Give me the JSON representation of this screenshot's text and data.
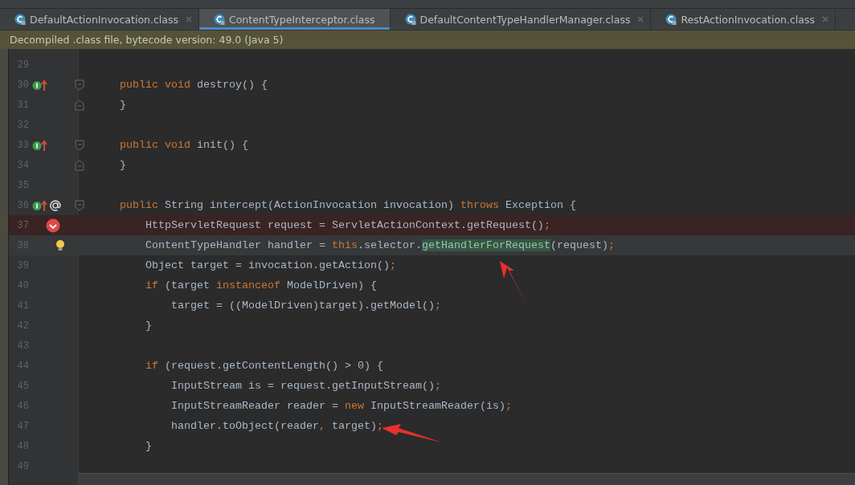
{
  "tabs": [
    {
      "label": "DefaultActionInvocation.class",
      "selected": false
    },
    {
      "label": "ContentTypeInterceptor.class",
      "selected": true
    },
    {
      "label": "DefaultContentTypeHandlerManager.class",
      "selected": false
    },
    {
      "label": "RestActionInvocation.class",
      "selected": false
    }
  ],
  "banner": "Decompiled .class file, bytecode version: 49.0 (Java 5)",
  "lines": [
    {
      "number": "29"
    },
    {
      "number": "30",
      "gutter": [
        {
          "kind": "implements"
        }
      ],
      "fold_start": true,
      "tokens": [
        {
          "text": "    public void ",
          "kind": "keyword"
        },
        {
          "text": "destroy() {",
          "kind": "plain"
        }
      ]
    },
    {
      "number": "31",
      "fold_end": true,
      "tokens": [
        {
          "text": "    }",
          "kind": "plain"
        }
      ]
    },
    {
      "number": "32"
    },
    {
      "number": "33",
      "gutter": [
        {
          "kind": "implements"
        }
      ],
      "fold_start": true,
      "tokens": [
        {
          "text": "    public void ",
          "kind": "keyword"
        },
        {
          "text": "init() {",
          "kind": "plain"
        }
      ]
    },
    {
      "number": "34",
      "fold_end": true,
      "tokens": [
        {
          "text": "    }",
          "kind": "plain"
        }
      ]
    },
    {
      "number": "35"
    },
    {
      "number": "36",
      "gutter": [
        {
          "kind": "implements"
        },
        {
          "kind": "annotation"
        }
      ],
      "fold_start": true,
      "tokens": [
        {
          "text": "    public ",
          "kind": "keyword"
        },
        {
          "text": "String intercept(ActionInvocation invocation) ",
          "kind": "plain"
        },
        {
          "text": "throws ",
          "kind": "keyword"
        },
        {
          "text": "Exception {",
          "kind": "plain"
        }
      ]
    },
    {
      "number": "37",
      "gutter": [
        {
          "kind": "breakpoint"
        }
      ],
      "breakpoint": true,
      "tokens": [
        {
          "text": "        HttpServletRequest request = ServletActionContext.getRequest()",
          "kind": "plain"
        },
        {
          "text": ";",
          "kind": "keyword"
        }
      ]
    },
    {
      "number": "38",
      "gutter": [
        {
          "kind": "bulb"
        }
      ],
      "current": true,
      "tokens": [
        {
          "text": "        ContentTypeHandler handler = ",
          "kind": "plain"
        },
        {
          "text": "this",
          "kind": "keyword"
        },
        {
          "text": ".selector.",
          "kind": "plain"
        },
        {
          "text": "getHandlerForRequest",
          "kind": "match"
        },
        {
          "text": "(request)",
          "kind": "plain"
        },
        {
          "text": ";",
          "kind": "keyword"
        }
      ]
    },
    {
      "number": "39",
      "tokens": [
        {
          "text": "        Object target = invocation.getAction()",
          "kind": "plain"
        },
        {
          "text": ";",
          "kind": "keyword"
        }
      ]
    },
    {
      "number": "40",
      "tokens": [
        {
          "text": "        if ",
          "kind": "keyword"
        },
        {
          "text": "(target ",
          "kind": "plain"
        },
        {
          "text": "instanceof ",
          "kind": "keyword"
        },
        {
          "text": "ModelDriven) {",
          "kind": "plain"
        }
      ]
    },
    {
      "number": "41",
      "tokens": [
        {
          "text": "            target = ((ModelDriven)target).getModel()",
          "kind": "plain"
        },
        {
          "text": ";",
          "kind": "keyword"
        }
      ]
    },
    {
      "number": "42",
      "tokens": [
        {
          "text": "        }",
          "kind": "plain"
        }
      ]
    },
    {
      "number": "43"
    },
    {
      "number": "44",
      "tokens": [
        {
          "text": "        if ",
          "kind": "keyword"
        },
        {
          "text": "(request.getContentLength() > 0) {",
          "kind": "plain"
        }
      ]
    },
    {
      "number": "45",
      "tokens": [
        {
          "text": "            InputStream is = request.getInputStream()",
          "kind": "plain"
        },
        {
          "text": ";",
          "kind": "keyword"
        }
      ]
    },
    {
      "number": "46",
      "tokens": [
        {
          "text": "            InputStreamReader reader = ",
          "kind": "plain"
        },
        {
          "text": "new ",
          "kind": "keyword"
        },
        {
          "text": "InputStreamReader(is)",
          "kind": "plain"
        },
        {
          "text": ";",
          "kind": "keyword"
        }
      ]
    },
    {
      "number": "47",
      "tokens": [
        {
          "text": "            handler.toObject(reader",
          "kind": "plain"
        },
        {
          "text": ", ",
          "kind": "keyword"
        },
        {
          "text": "target)",
          "kind": "plain"
        },
        {
          "text": ";",
          "kind": "keyword"
        }
      ]
    },
    {
      "number": "48",
      "tokens": [
        {
          "text": "        }",
          "kind": "plain"
        }
      ]
    },
    {
      "number": "49"
    }
  ]
}
